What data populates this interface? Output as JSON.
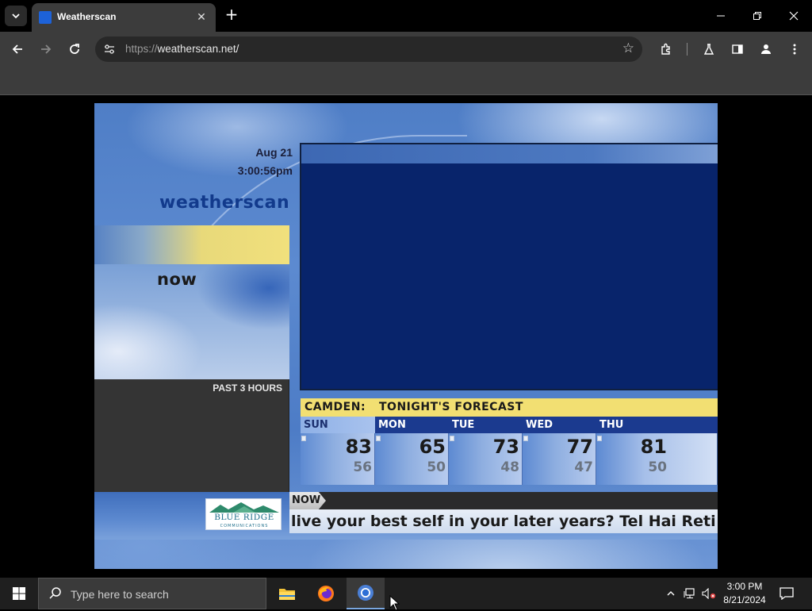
{
  "browser": {
    "tab": {
      "title": "Weatherscan",
      "favicon_text": "The Weather Channel"
    },
    "url_scheme": "https://",
    "url_rest": "weatherscan.net/",
    "icons": {
      "tab_list": "chevron-down-icon",
      "new_tab": "plus-icon",
      "back": "arrow-left-icon",
      "forward": "arrow-right-icon",
      "reload": "reload-icon",
      "bookmark": "star-icon"
    }
  },
  "weatherscan": {
    "date": "Aug 21",
    "time": "3:00:56pm",
    "logo": "weatherscan",
    "now_label": "now",
    "past_label": "PAST 3 HOURS",
    "forecast": {
      "city": "CAMDEN:",
      "subtitle": "TONIGHT'S FORECAST",
      "days": [
        {
          "name": "SUN",
          "hi": "83",
          "lo": "56"
        },
        {
          "name": "MON",
          "hi": "65",
          "lo": "50"
        },
        {
          "name": "TUE",
          "hi": "73",
          "lo": "48"
        },
        {
          "name": "WED",
          "hi": "77",
          "lo": "47"
        },
        {
          "name": "THU",
          "hi": "81",
          "lo": "50"
        }
      ]
    },
    "sponsor": {
      "name": "BLUE RIDGE",
      "sub": "COMMUNICATIONS"
    },
    "ticker_tag": "NOW",
    "ticker_text": "live your best self in your later years? Tel Hai Reti"
  },
  "taskbar": {
    "search_placeholder": "Type here to search",
    "time": "3:00 PM",
    "date": "8/21/2024"
  },
  "colors": {
    "weatherscan_navy": "#08246b",
    "forecast_yellow": "#f2df72",
    "day_header_blue": "#1b3a8f"
  }
}
